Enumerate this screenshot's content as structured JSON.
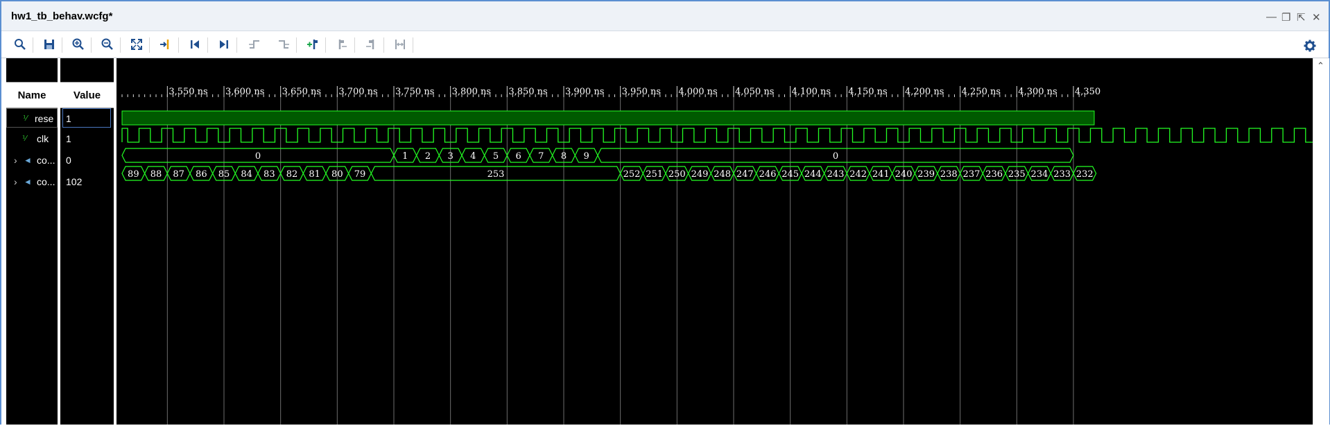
{
  "window": {
    "title": "hw1_tb_behav.wcfg*",
    "controls": [
      "minimize-icon",
      "restore-icon",
      "maximize-icon",
      "close-icon"
    ]
  },
  "toolbar": {
    "buttons": [
      "search-icon",
      "save-icon",
      "zoom-in-icon",
      "zoom-out-icon",
      "zoom-fit-icon",
      "go-to-cursor-icon",
      "go-to-time-zero-icon",
      "go-to-last-time-icon",
      "previous-transition-icon",
      "next-transition-icon",
      "add-marker-icon",
      "previous-marker-icon",
      "next-marker-icon",
      "swap-cursors-icon"
    ],
    "settings": "gear-icon"
  },
  "columns": {
    "name": "Name",
    "value": "Value"
  },
  "signals": [
    {
      "name": "rese",
      "value": "1",
      "icon": "logic-signal-icon",
      "expandable": false
    },
    {
      "name": "clk",
      "value": "1",
      "icon": "logic-signal-icon",
      "expandable": false
    },
    {
      "name": "co...",
      "value": "0",
      "icon": "bus-signal-icon",
      "expandable": true
    },
    {
      "name": "co...",
      "value": "102",
      "icon": "bus-signal-icon",
      "expandable": true
    }
  ],
  "timeline": {
    "unit": "ns",
    "start": 3510,
    "end": 4350,
    "labels": [
      "3,550 ns",
      "3,600 ns",
      "3,650 ns",
      "3,700 ns",
      "3,750 ns",
      "3,800 ns",
      "3,850 ns",
      "3,900 ns",
      "3,950 ns",
      "4,000 ns",
      "4,050 ns",
      "4,100 ns",
      "4,150 ns",
      "4,200 ns",
      "4,250 ns",
      "4,300 ns",
      "4,350"
    ],
    "label_times": [
      3550,
      3600,
      3650,
      3700,
      3750,
      3800,
      3850,
      3900,
      3950,
      4000,
      4050,
      4100,
      4150,
      4200,
      4250,
      4300,
      4350
    ],
    "clock_period": 20,
    "clock_high_first": 5
  },
  "waves": {
    "count_up": [
      {
        "t0": 3510,
        "t1": 3750,
        "v": "0"
      },
      {
        "t0": 3750,
        "t1": 3770,
        "v": "1"
      },
      {
        "t0": 3770,
        "t1": 3790,
        "v": "2"
      },
      {
        "t0": 3790,
        "t1": 3810,
        "v": "3"
      },
      {
        "t0": 3810,
        "t1": 3830,
        "v": "4"
      },
      {
        "t0": 3830,
        "t1": 3850,
        "v": "5"
      },
      {
        "t0": 3850,
        "t1": 3870,
        "v": "6"
      },
      {
        "t0": 3870,
        "t1": 3890,
        "v": "7"
      },
      {
        "t0": 3890,
        "t1": 3910,
        "v": "8"
      },
      {
        "t0": 3910,
        "t1": 3930,
        "v": "9"
      },
      {
        "t0": 3930,
        "t1": 4350,
        "v": "0"
      }
    ],
    "count_down": [
      {
        "t0": 3510,
        "t1": 3530,
        "v": "89"
      },
      {
        "t0": 3530,
        "t1": 3550,
        "v": "88"
      },
      {
        "t0": 3550,
        "t1": 3570,
        "v": "87"
      },
      {
        "t0": 3570,
        "t1": 3590,
        "v": "86"
      },
      {
        "t0": 3590,
        "t1": 3610,
        "v": "85"
      },
      {
        "t0": 3610,
        "t1": 3630,
        "v": "84"
      },
      {
        "t0": 3630,
        "t1": 3650,
        "v": "83"
      },
      {
        "t0": 3650,
        "t1": 3670,
        "v": "82"
      },
      {
        "t0": 3670,
        "t1": 3690,
        "v": "81"
      },
      {
        "t0": 3690,
        "t1": 3710,
        "v": "80"
      },
      {
        "t0": 3710,
        "t1": 3730,
        "v": "79"
      },
      {
        "t0": 3730,
        "t1": 3950,
        "v": "253"
      },
      {
        "t0": 3950,
        "t1": 3970,
        "v": "252"
      },
      {
        "t0": 3970,
        "t1": 3990,
        "v": "251"
      },
      {
        "t0": 3990,
        "t1": 4010,
        "v": "250"
      },
      {
        "t0": 4010,
        "t1": 4030,
        "v": "249"
      },
      {
        "t0": 4030,
        "t1": 4050,
        "v": "248"
      },
      {
        "t0": 4050,
        "t1": 4070,
        "v": "247"
      },
      {
        "t0": 4070,
        "t1": 4090,
        "v": "246"
      },
      {
        "t0": 4090,
        "t1": 4110,
        "v": "245"
      },
      {
        "t0": 4110,
        "t1": 4130,
        "v": "244"
      },
      {
        "t0": 4130,
        "t1": 4150,
        "v": "243"
      },
      {
        "t0": 4150,
        "t1": 4170,
        "v": "242"
      },
      {
        "t0": 4170,
        "t1": 4190,
        "v": "241"
      },
      {
        "t0": 4190,
        "t1": 4210,
        "v": "240"
      },
      {
        "t0": 4210,
        "t1": 4230,
        "v": "239"
      },
      {
        "t0": 4230,
        "t1": 4250,
        "v": "238"
      },
      {
        "t0": 4250,
        "t1": 4270,
        "v": "237"
      },
      {
        "t0": 4270,
        "t1": 4290,
        "v": "236"
      },
      {
        "t0": 4290,
        "t1": 4310,
        "v": "235"
      },
      {
        "t0": 4310,
        "t1": 4330,
        "v": "234"
      },
      {
        "t0": 4330,
        "t1": 4350,
        "v": "233"
      },
      {
        "t0": 4350,
        "t1": 4370,
        "v": "232"
      }
    ]
  },
  "colors": {
    "wave": "#23ff23",
    "fill": "#005a00",
    "grid": "#6e6e6e",
    "background": "#000000",
    "accent": "#5b8fd1"
  }
}
